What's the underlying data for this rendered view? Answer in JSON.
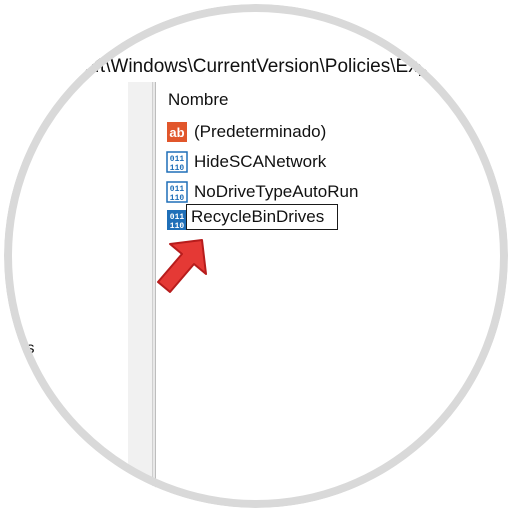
{
  "window": {
    "address_path": "oft\\Windows\\CurrentVersion\\Policies\\Exp"
  },
  "tree": {
    "partial_item": "ts"
  },
  "list": {
    "column_header": "Nombre",
    "items": [
      {
        "name": "(Predeterminado)",
        "icon": "ab-string-icon"
      },
      {
        "name": "HideSCANetwork",
        "icon": "binary-value-icon"
      },
      {
        "name": "NoDriveTypeAutoRun",
        "icon": "binary-value-icon"
      }
    ],
    "editing_item": {
      "value": "RecycleBinDrives",
      "icon": "binary-value-icon"
    }
  },
  "colors": {
    "accent": "#e53935",
    "ring": "#d9d9d9",
    "icon_blue": "#1f6fb8",
    "string_icon": "#e1562b"
  }
}
